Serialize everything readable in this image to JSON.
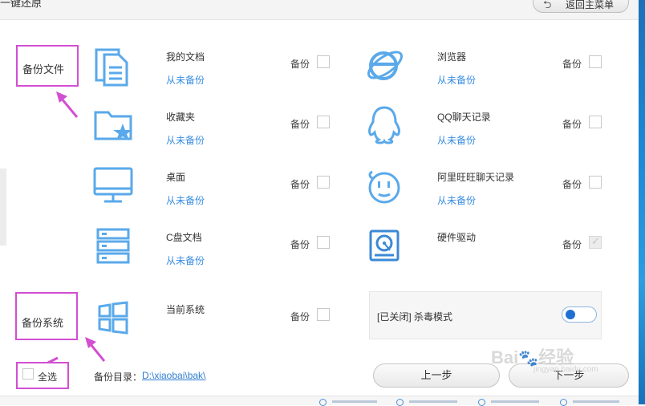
{
  "window": {
    "title": "一键还原"
  },
  "header": {
    "return_label": "返回主菜单",
    "return_icon": "return-arrow-icon"
  },
  "sections": {
    "files_label": "备份文件",
    "system_label": "备份系统"
  },
  "backup_label": "备份",
  "items": [
    {
      "name": "我的文档",
      "status": "从未备份",
      "icon": "documents-icon",
      "checked": false
    },
    {
      "name": "浏览器",
      "status": "从未备份",
      "icon": "browser-icon",
      "checked": false
    },
    {
      "name": "收藏夹",
      "status": "从未备份",
      "icon": "favorites-folder-icon",
      "checked": false
    },
    {
      "name": "QQ聊天记录",
      "status": "从未备份",
      "icon": "qq-icon",
      "checked": false
    },
    {
      "name": "桌面",
      "status": "从未备份",
      "icon": "monitor-icon",
      "checked": false
    },
    {
      "name": "阿里旺旺聊天记录",
      "status": "从未备份",
      "icon": "wangwang-icon",
      "checked": false
    },
    {
      "name": "C盘文档",
      "status": "从未备份",
      "icon": "server-icon",
      "checked": false
    },
    {
      "name": "硬件驱动",
      "status": "",
      "icon": "hard-disk-icon",
      "checked": true,
      "disabled": true
    },
    {
      "name": "当前系统",
      "status": "",
      "icon": "windows-icon",
      "checked": false
    }
  ],
  "antivirus": {
    "label": "[已关闭] 杀毒模式",
    "enabled": false
  },
  "footer": {
    "select_all": "全选",
    "dir_label": "备份目录：",
    "dir_value": "D:\\xiaobai\\bak\\",
    "prev_label": "上一步",
    "next_label": "下一步"
  },
  "colors": {
    "accent": "#3a8ee0",
    "icon": "#5aa9ea",
    "highlight": "#d24fd2",
    "toggle": "#1f6fd2"
  },
  "watermark": "Baidu 经验 jingyan.baidu.com"
}
